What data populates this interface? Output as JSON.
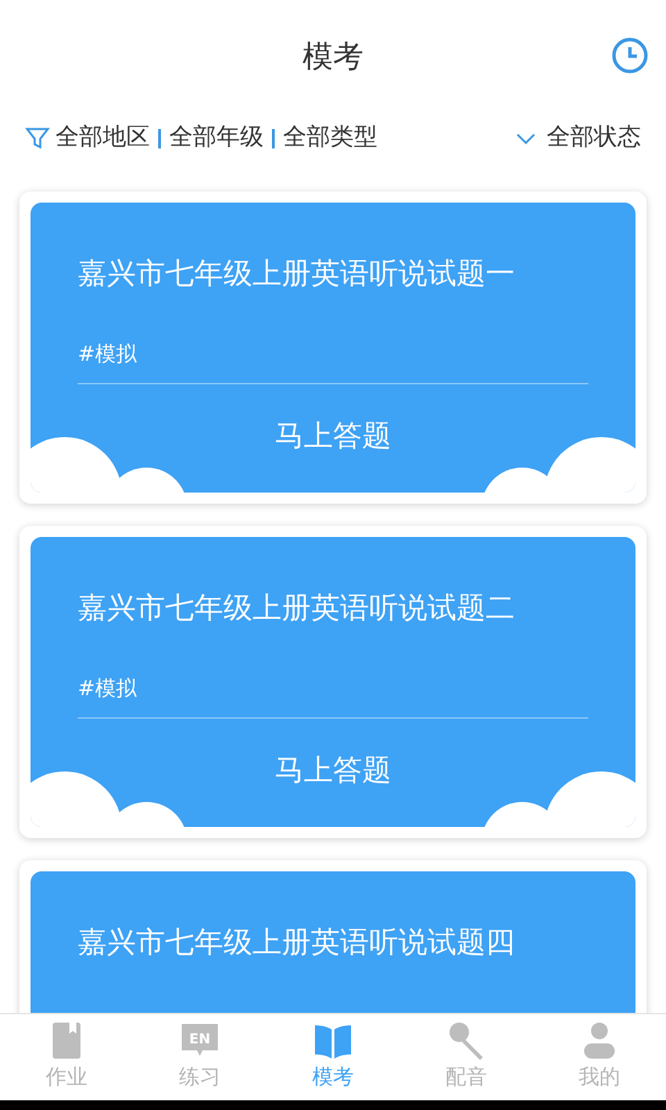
{
  "header": {
    "title": "模考"
  },
  "filters": {
    "items": [
      "全部地区",
      "全部年级",
      "全部类型"
    ],
    "status": "全部状态"
  },
  "exams": [
    {
      "title": "嘉兴市七年级上册英语听说试题一",
      "tag": "#模拟",
      "action": "马上答题"
    },
    {
      "title": "嘉兴市七年级上册英语听说试题二",
      "tag": "#模拟",
      "action": "马上答题"
    },
    {
      "title": "嘉兴市七年级上册英语听说试题四"
    }
  ],
  "nav": [
    {
      "label": "作业",
      "kind": "book",
      "selected": false
    },
    {
      "label": "练习",
      "kind": "en",
      "icon_text": "EN",
      "selected": false
    },
    {
      "label": "模考",
      "kind": "open",
      "selected": true
    },
    {
      "label": "配音",
      "kind": "mic",
      "selected": false
    },
    {
      "label": "我的",
      "kind": "user",
      "selected": false
    }
  ]
}
